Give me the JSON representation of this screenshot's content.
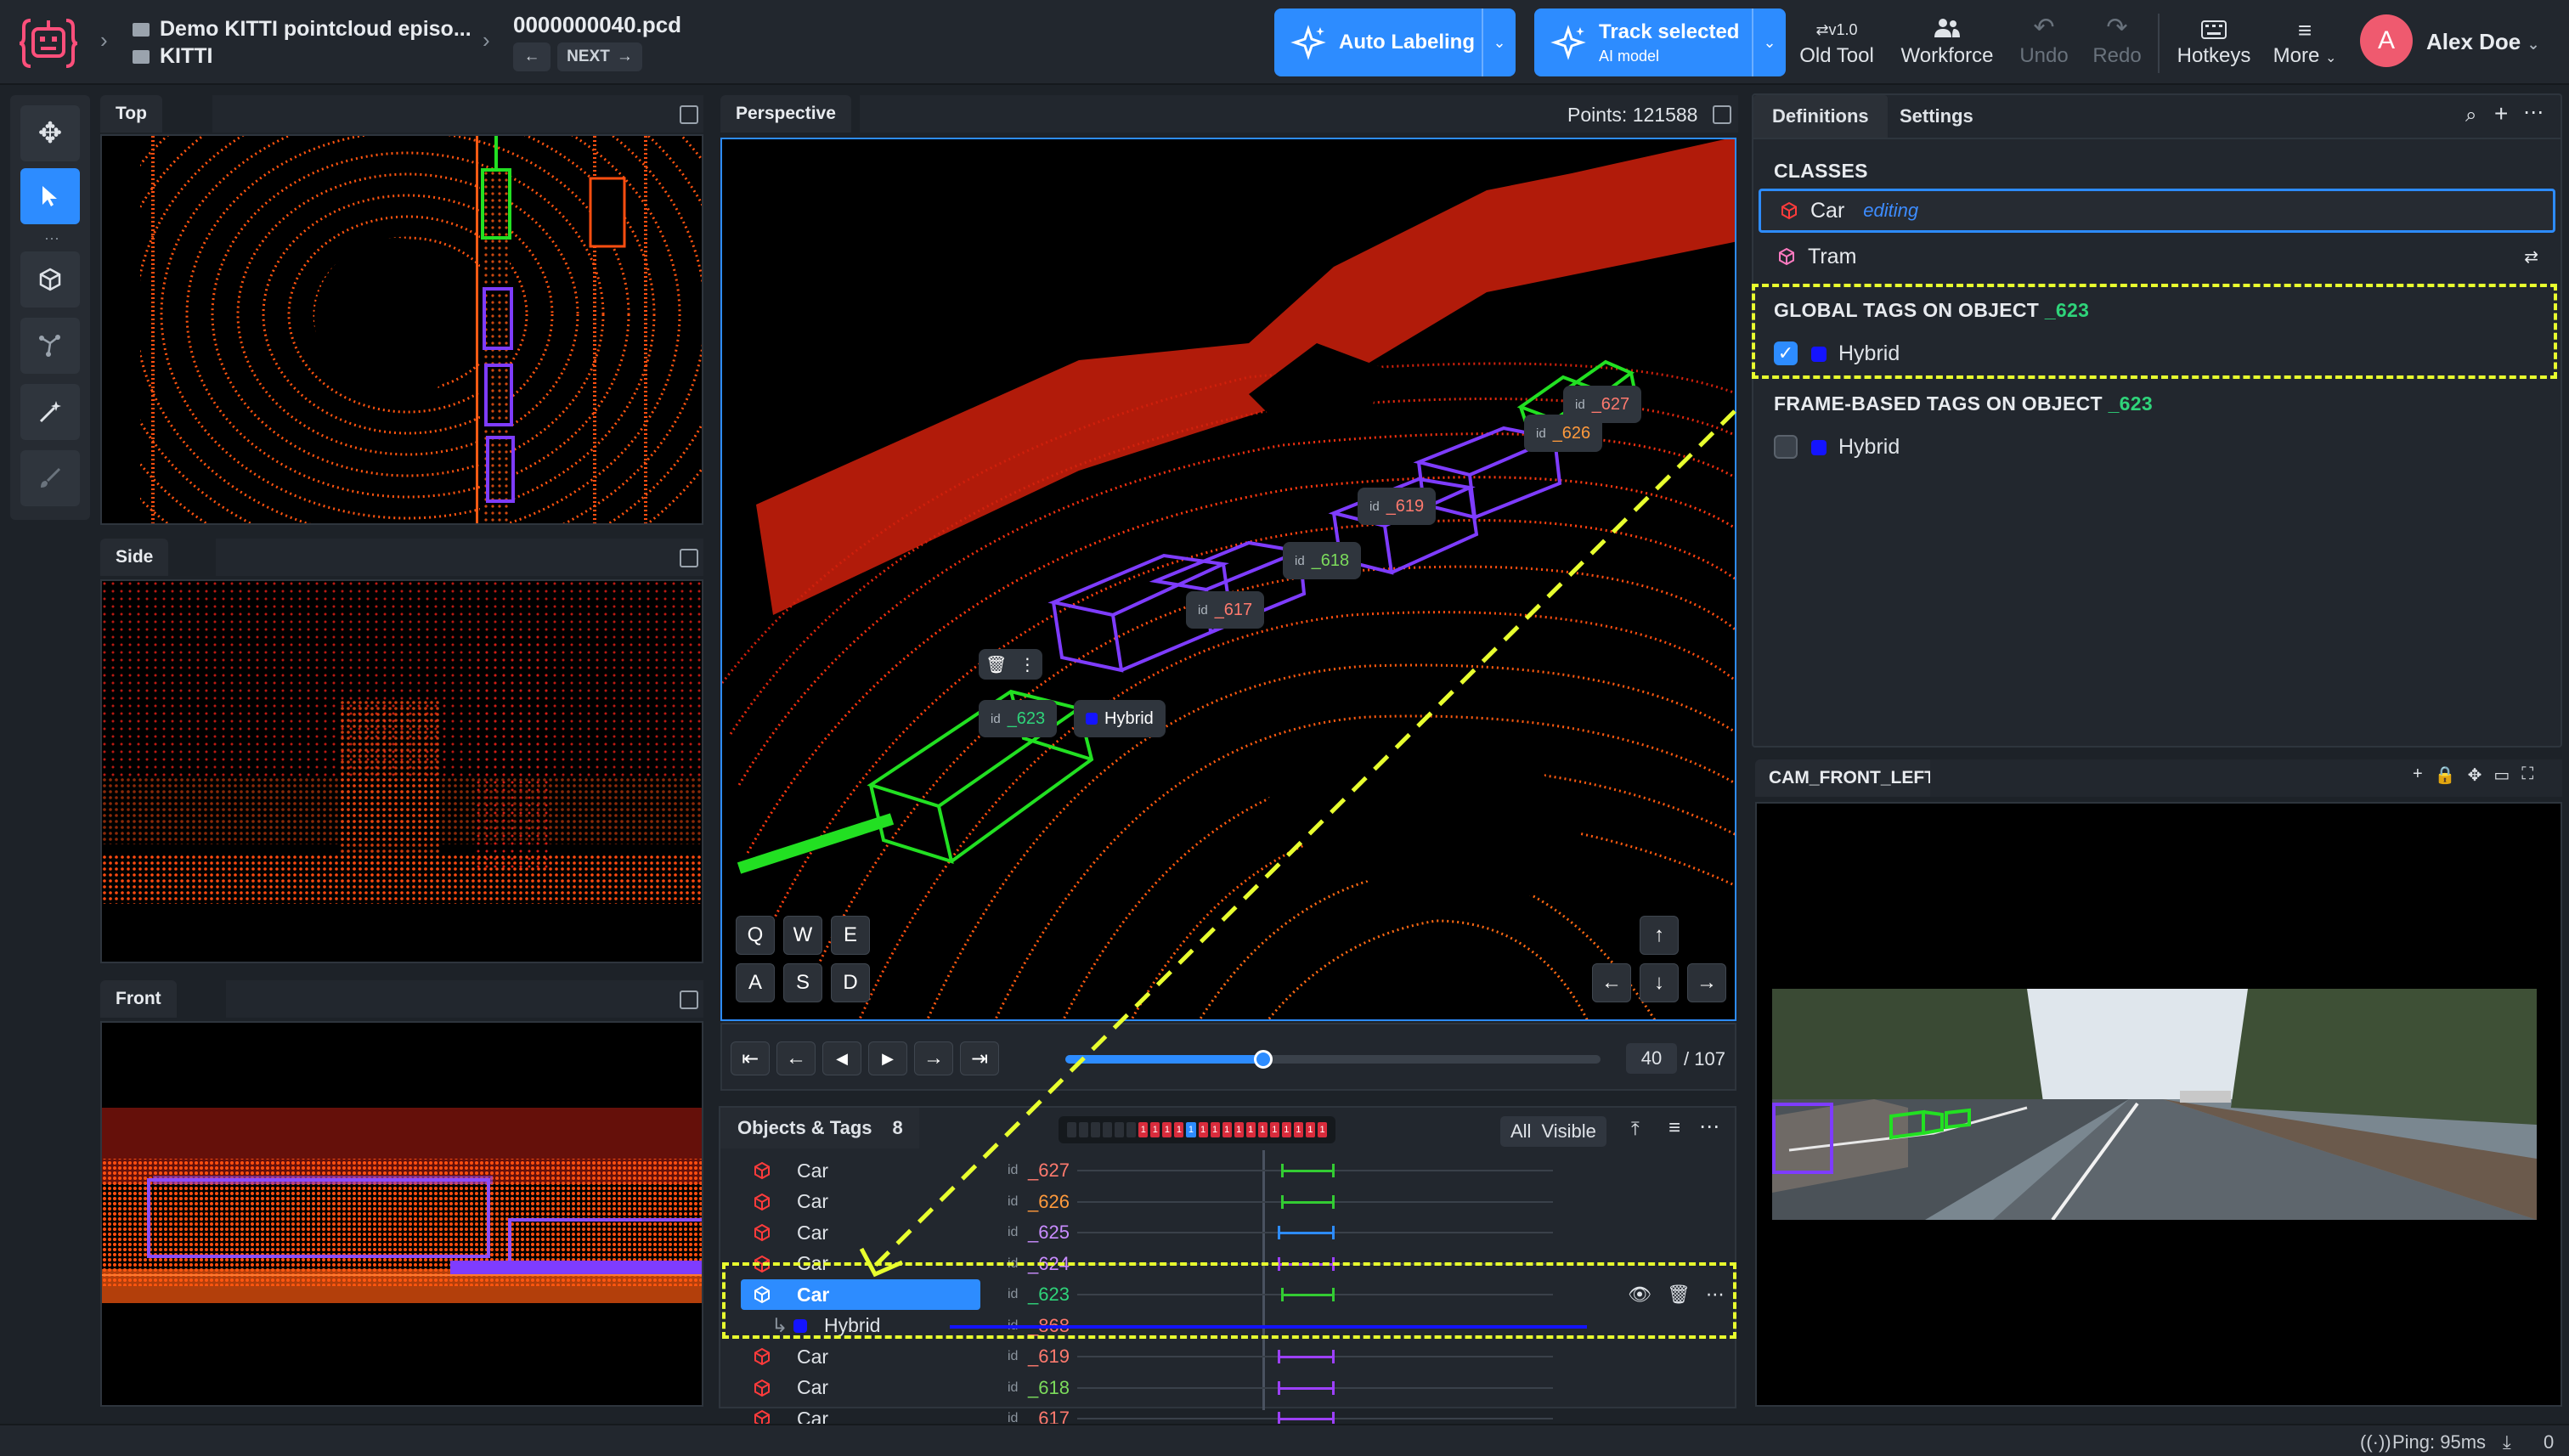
{
  "header": {
    "project_title": "Demo KITTI pointcloud episo...",
    "dataset": "KITTI",
    "file_name": "0000000040.pcd",
    "next_label": "NEXT",
    "auto_labeling": "Auto Labeling",
    "track_selected": "Track selected",
    "track_sub": "AI model",
    "old_tool": "Old Tool",
    "old_tool_version": "v1.0",
    "workforce": "Workforce",
    "undo": "Undo",
    "redo": "Redo",
    "hotkeys": "Hotkeys",
    "more": "More",
    "user_initial": "A",
    "user_name": "Alex Doe"
  },
  "views": {
    "top": "Top",
    "side": "Side",
    "front": "Front",
    "perspective": "Perspective",
    "points_label": "Points: 121588"
  },
  "perspective_labels": [
    {
      "id": "_627",
      "color": "#ff7a6e"
    },
    {
      "id": "_626",
      "color": "#ff9a3c"
    },
    {
      "id": "_619",
      "color": "#ff7a6e"
    },
    {
      "id": "_618",
      "color": "#7cdc5c"
    },
    {
      "id": "_617",
      "color": "#ff7a6e"
    },
    {
      "id": "_623",
      "color": "#2fd47a"
    }
  ],
  "perspective_tag": "Hybrid",
  "keys": [
    "Q",
    "W",
    "E",
    "A",
    "S",
    "D"
  ],
  "playback": {
    "frame": "40",
    "total": "/ 107",
    "progress": 0.37
  },
  "objects_panel": {
    "title": "Objects & Tags",
    "count": "8",
    "filter_all": "All",
    "filter_visible": "Visible",
    "frame_marks": [
      "1",
      "1",
      "1",
      "1",
      "1",
      "1",
      "1",
      "1",
      "1",
      "1",
      "1",
      "1",
      "1",
      "1",
      "1",
      "1"
    ],
    "rows": [
      {
        "name": "Car",
        "id": "_627",
        "idcolor": "#ff7a6e",
        "track": "#33cc33"
      },
      {
        "name": "Car",
        "id": "_626",
        "idcolor": "#ff9a3c",
        "track": "#33cc33"
      },
      {
        "name": "Car",
        "id": "_625",
        "idcolor": "#c98cff",
        "track": "#2d8cff"
      },
      {
        "name": "Car",
        "id": "_624",
        "idcolor": "#c98cff",
        "track": "#9d40ff"
      },
      {
        "name": "Car",
        "id": "_623",
        "idcolor": "#2fd47a",
        "track": "#33cc33"
      },
      {
        "name": "Hybrid",
        "id": "_868",
        "idcolor": "#ff7a6e",
        "track": "#1414ff"
      },
      {
        "name": "Car",
        "id": "_619",
        "idcolor": "#ff7a6e",
        "track": "#9d40ff"
      },
      {
        "name": "Car",
        "id": "_618",
        "idcolor": "#7cdc5c",
        "track": "#9d40ff"
      },
      {
        "name": "Car",
        "id": "_617",
        "idcolor": "#ff7a6e",
        "track": "#9d40ff"
      }
    ]
  },
  "definitions": {
    "tab_definitions": "Definitions",
    "tab_settings": "Settings",
    "classes_title": "CLASSES",
    "class_car": "Car",
    "class_car_status": "editing",
    "class_tram": "Tram",
    "global_tags_title": "GLOBAL TAGS ON OBJECT",
    "global_tags_id": "_623",
    "global_tag": "Hybrid",
    "global_tag_checked": true,
    "frame_tags_title": "FRAME-BASED TAGS ON OBJECT",
    "frame_tags_id": "_623",
    "frame_tag": "Hybrid",
    "frame_tag_checked": false
  },
  "camera": {
    "title": "CAM_FRONT_LEFT"
  },
  "status": {
    "ping": "Ping: 95ms",
    "count": "0"
  },
  "colors": {
    "accent": "#2d8cff",
    "highlight": "#e8ff2e",
    "id_green": "#2fd47a"
  }
}
